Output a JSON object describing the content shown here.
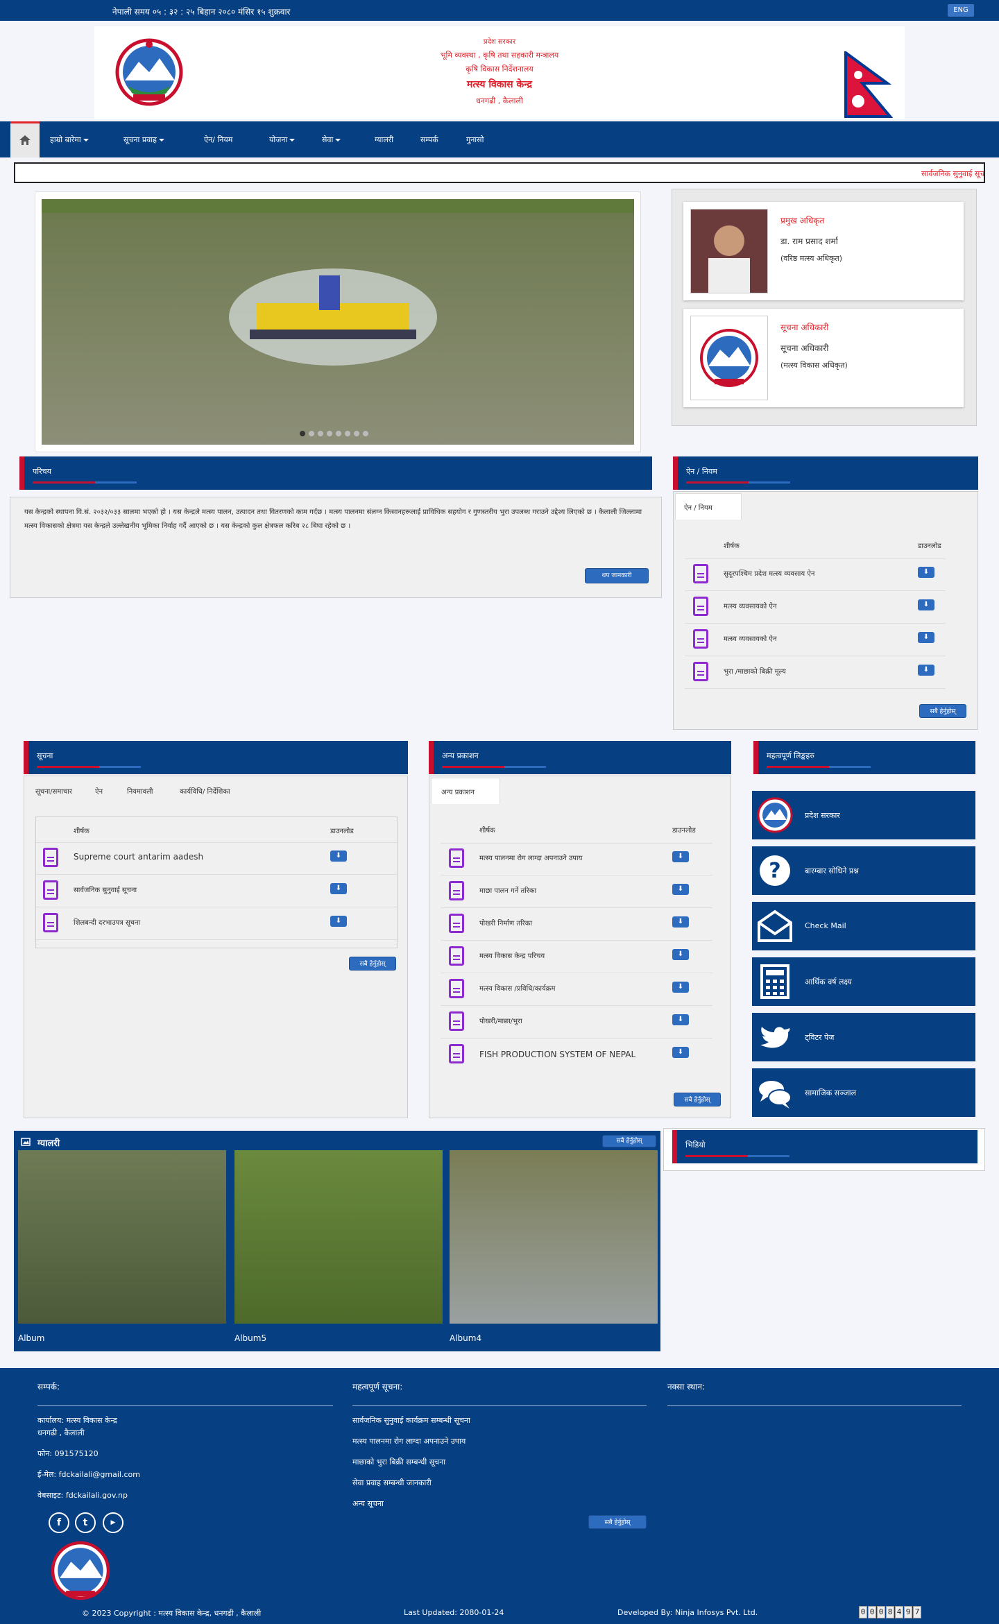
{
  "topbar": {
    "time": "नेपाली समय ०५ : ३२ : २५ बिहान   २०८० मंसिर १५ शुक्रवार",
    "lang_button": "ENG"
  },
  "header": {
    "line1": "प्रदेश सरकार",
    "line2": "भूमि व्यवस्था , कृषि तथा सहकारी मन्त्रालय",
    "line3": "कृषि विकास निर्देशनालय",
    "line4": "मत्स्य विकास केन्द्र",
    "line5": "धनगढी , कैलाली"
  },
  "nav": {
    "items": [
      {
        "label": "हाम्रो बारेमा",
        "dropdown": true
      },
      {
        "label": "सूचना प्रवाह",
        "dropdown": true
      },
      {
        "label": "ऐन/ नियम",
        "dropdown": false
      },
      {
        "label": "योजना",
        "dropdown": true
      },
      {
        "label": "सेवा",
        "dropdown": true
      },
      {
        "label": "ग्यालरी",
        "dropdown": false
      },
      {
        "label": "सम्पर्क",
        "dropdown": false
      },
      {
        "label": "गुनासो",
        "dropdown": false
      }
    ]
  },
  "ticker": {
    "text": "सार्वजनिक सुनुवाई सूचना"
  },
  "profiles": [
    {
      "role": "प्रमुख अधिकृत",
      "name": "डा. राम प्रसाद शर्मा",
      "title": "(वरिष्ठ मत्स्य अधिकृत)"
    },
    {
      "role": "सूचना अधिकारी",
      "name": "सूचना अधिकारी",
      "title": "(मत्स्य विकास अधिकृत)"
    }
  ],
  "about": {
    "title": "परिचय",
    "text": "यस केन्द्रको स्थापना वि.सं. २०३२/०३३ सालमा भएको हो । यस केन्द्रले मत्स्य पालन, उत्पादन तथा वितरणको काम गर्दछ । मत्स्य पालनमा संलग्न किसानहरूलाई प्राविधिक सहयोग र गुणस्तरीय भुरा उपलब्ध गराउने उद्देश्य लिएको छ । कैलाली जिल्लामा मत्स्य विकासको क्षेत्रमा यस केन्द्रले उल्लेखनीय भूमिका निर्वाह गर्दै आएको छ । यस केन्द्रको कुल क्षेत्रफल करिब २८ बिघा रहेको छ ।",
    "more_button": "थप जानकारी"
  },
  "acts": {
    "title": "ऐन / नियम",
    "tab": "ऐन / नियम",
    "col_title": "शीर्षक",
    "col_download": "डाउनलोड",
    "rows": [
      "सुदूरपश्चिम प्रदेश मत्स्य व्यवसाय ऐन",
      "मत्स्य व्यवसायको ऐन",
      "मत्स्य व्यवसायको ऐन",
      "भुरा /माछाको बिक्री मूल्य"
    ],
    "all_button": "सबै हेर्नुहोस्"
  },
  "notices": {
    "title": "सूचना",
    "tabs": [
      "सूचना/समाचार",
      "ऐन",
      "नियमावली",
      "कार्यविधि/ निर्देशिका"
    ],
    "col_title": "शीर्षक",
    "col_download": "डाउनलोड",
    "rows": [
      "Supreme court antarim aadesh",
      "सार्वजनिक सुनुवाई सूचना",
      "शिलबन्दी दरभाउपत्र सूचना"
    ],
    "all_button": "सबै हेर्नुहोस्"
  },
  "publications": {
    "title": "अन्य प्रकाशन",
    "tab": "अन्य प्रकाशन",
    "col_title": "शीर्षक",
    "col_download": "डाउनलोड",
    "rows": [
      "मत्स्य पालनमा रोग लाग्दा अपनाउने उपाय",
      "माछा पालन गर्ने तरिका",
      "पोखरी निर्माण तरिका",
      "मत्स्य विकास केन्द्र परिचय",
      "मत्स्य विकास /प्रविधि/कार्यक्रम",
      "पोखरी/माछा/भुरा",
      "FISH PRODUCTION SYSTEM OF NEPAL"
    ],
    "all_button": "सबै हेर्नुहोस्"
  },
  "links": {
    "title": "महत्वपूर्ण लिङ्कहरु",
    "items": [
      {
        "label": "प्रदेश सरकार",
        "icon": "emblem-icon"
      },
      {
        "label": "बारम्बार सोधिने प्रश्न",
        "icon": "question-icon"
      },
      {
        "label": "Check Mail",
        "icon": "mail-icon"
      },
      {
        "label": "आर्थिक वर्ष लक्ष्य",
        "icon": "calculator-icon"
      },
      {
        "label": "ट्विटर पेज",
        "icon": "twitter-icon"
      },
      {
        "label": "सामाजिक सञ्जाल",
        "icon": "chat-icon"
      }
    ]
  },
  "gallery": {
    "title": "ग्यालरी",
    "all_button": "सबै हेर्नुहोस्",
    "albums": [
      "Album",
      "Album5",
      "Album4"
    ]
  },
  "video": {
    "title": "भिडियो"
  },
  "footer": {
    "contact_title": "सम्पर्क:",
    "contact_office": "कार्यालय: मत्स्य विकास केन्द्र",
    "contact_address": "धनगढी , कैलाली",
    "phone": "फोन: 091575120",
    "email": "ई-मेल: fdckailali@gmail.com",
    "website": "वेबसाइट: fdckailali.gov.np",
    "notices_title": "महत्वपूर्ण सूचना:",
    "notices": [
      "सार्वजनिक सुनुवाई कार्यक्रम सम्बन्धी सूचना",
      "मत्स्य पालनमा रोग लाग्दा अपनाउने उपाय",
      "माछाको भुरा बिक्री सम्बन्धी सूचना",
      "सेवा प्रवाह सम्बन्धी जानकारी",
      "अन्य सूचना"
    ],
    "more_button": "सबै हेर्नुहोस्",
    "map_title": "नक्सा स्थान:",
    "copyright": "© 2023 Copyright : मत्स्य विकास केन्द्र, धनगढी , कैलाली",
    "updated": "Last Updated: 2080-01-24",
    "developer": "Developed By: Ninja Infosys Pvt. Ltd.",
    "counter": "0008497"
  },
  "colors": {
    "primary": "#063f82",
    "accent": "#c8102e",
    "button": "#2d6bbf"
  }
}
